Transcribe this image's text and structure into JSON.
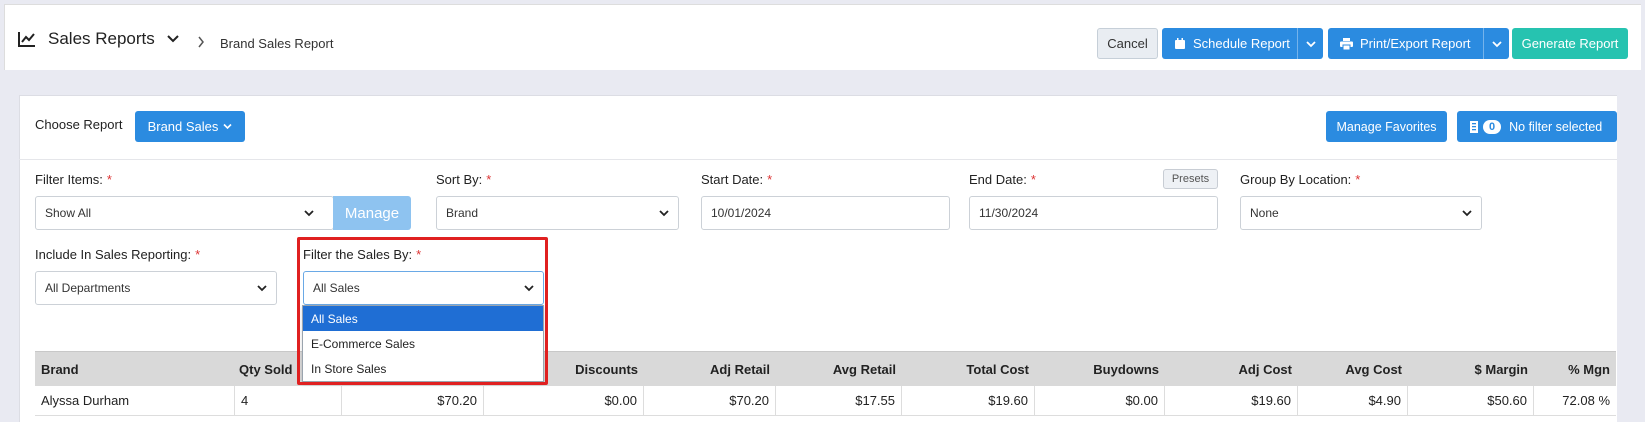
{
  "header": {
    "title": "Sales Reports",
    "breadcrumb": "Brand Sales Report",
    "cancel_label": "Cancel",
    "schedule_label": "Schedule Report",
    "print_label": "Print/Export Report",
    "generate_label": "Generate Report"
  },
  "report": {
    "choose_label": "Choose Report",
    "brand_button": "Brand Sales",
    "manage_favorites": "Manage Favorites",
    "filter_count": "0",
    "filter_status": "No filter selected"
  },
  "filters": {
    "filter_items": {
      "label": "Filter Items:",
      "value": "Show All",
      "manage": "Manage"
    },
    "sort_by": {
      "label": "Sort By:",
      "value": "Brand"
    },
    "start_date": {
      "label": "Start Date:",
      "value": "10/01/2024"
    },
    "end_date": {
      "label": "End Date:",
      "value": "11/30/2024",
      "presets": "Presets"
    },
    "group_by": {
      "label": "Group By Location:",
      "value": "None"
    },
    "include": {
      "label": "Include In Sales Reporting:",
      "value": "All Departments"
    },
    "sales_by": {
      "label": "Filter the Sales By:",
      "value": "All Sales",
      "options": [
        "All Sales",
        "E-Commerce Sales",
        "In Store Sales"
      ]
    },
    "required_mark": "*"
  },
  "table": {
    "headers": [
      "Brand",
      "Qty Sold",
      "",
      "Discounts",
      "Adj Retail",
      "Avg Retail",
      "Total Cost",
      "Buydowns",
      "Adj Cost",
      "Avg Cost",
      "$ Margin",
      "% Mgn"
    ],
    "rows": [
      [
        "Alyssa Durham",
        "4",
        "$70.20",
        "$0.00",
        "$70.20",
        "$17.55",
        "$19.60",
        "$0.00",
        "$19.60",
        "$4.90",
        "$50.60",
        "72.08 %"
      ]
    ]
  },
  "colors": {
    "primary": "#2b8be0",
    "teal": "#26c3b0",
    "highlight": "#e02020",
    "selected": "#1f6ed4"
  }
}
